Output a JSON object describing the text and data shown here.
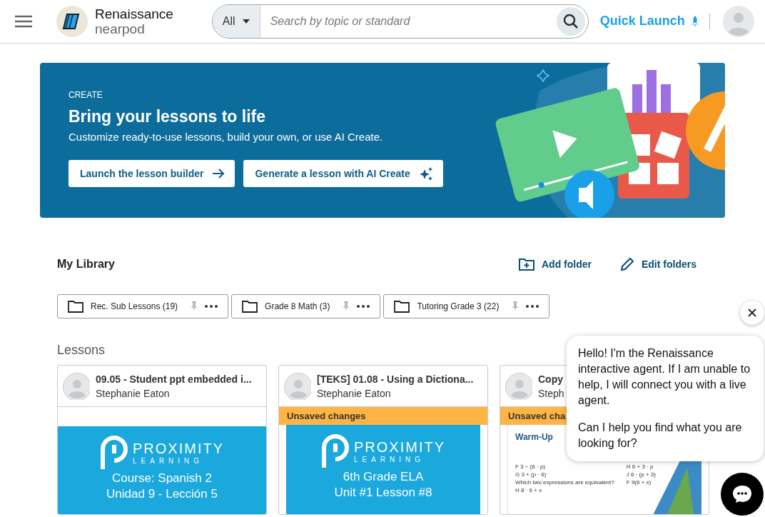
{
  "header": {
    "brand": "Renaissance",
    "product": "nearpod",
    "search": {
      "scope": "All",
      "placeholder": "Search by topic or standard"
    },
    "quick_launch": "Quick Launch"
  },
  "banner": {
    "eyebrow": "CREATE",
    "title": "Bring your lessons to life",
    "subtitle": "Customize ready-to-use lessons, build your own, or use AI Create.",
    "buttons": [
      {
        "label": "Launch the lesson builder",
        "kind": "arrow"
      },
      {
        "label": "Generate a lesson with AI Create",
        "kind": "sparkle"
      }
    ]
  },
  "library": {
    "title": "My Library",
    "actions": [
      {
        "label": "Add folder",
        "kind": "folder-plus"
      },
      {
        "label": "Edit folders",
        "kind": "pencil"
      }
    ],
    "folders": [
      {
        "name": "Rec. Sub Lessons (19)"
      },
      {
        "name": "Grade 8 Math (3)"
      },
      {
        "name": "Tutoring Grade 3 (22)"
      }
    ]
  },
  "lessons": {
    "title": "Lessons",
    "cards": [
      {
        "title": "09.05 - Student ppt embedded i...",
        "author": "Stephanie Eaton",
        "thumbnail": {
          "kind": "slide",
          "brand": "PROXIMITY",
          "brand_sub": "LEARNING",
          "lines": [
            "Course: Spanish 2",
            "Unidad 9 - Lección 5"
          ]
        }
      },
      {
        "title": "[TEKS] 01.08 - Using a Dictiona...",
        "author": "Stephanie Eaton",
        "status": "Unsaved changes",
        "thumbnail": {
          "kind": "slide",
          "brand": "PROXIMITY",
          "brand_sub": "LEARNING",
          "lines": [
            "6th Grade ELA",
            "Unit #1 Lesson #8"
          ]
        }
      },
      {
        "title": "Copy",
        "author": "Steph",
        "status": "Unsaved cha",
        "thumbnail": {
          "kind": "worksheet",
          "heading": "Warm-Up",
          "lines": [
            "F  3 − (6 · p)",
            "H  6 + 3 · p",
            "G  3 + (p · 6)",
            "J  6 · (p + 3)",
            "Which two expressions are equivalent?",
            "F  9(6 + x)",
            "H  8 · 6 + x"
          ]
        }
      }
    ]
  },
  "chat": {
    "messages": [
      "Hello! I'm the Renaissance interactive agent. If I am unable to help, I will connect you with a live agent.",
      "Can I help you find what you are looking for?"
    ]
  }
}
